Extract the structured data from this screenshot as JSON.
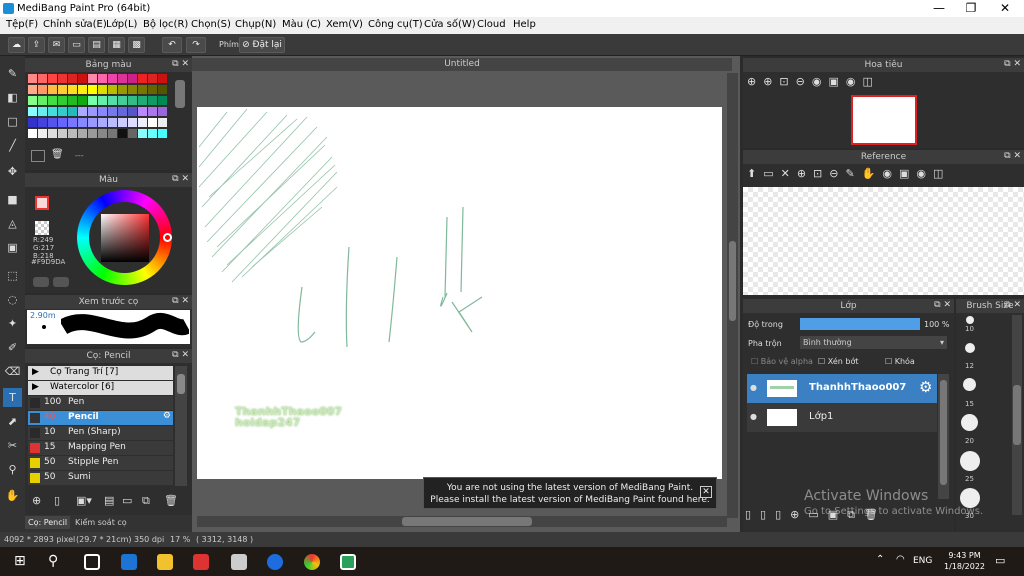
{
  "window": {
    "title": "MediBang Paint Pro (64bit)",
    "minimize": "—",
    "maximize": "❐",
    "close": "✕"
  },
  "menu": [
    "Tệp(F)",
    "Chỉnh sửa(E)",
    "Lớp(L)",
    "Bộ lọc(R)",
    "Chọn(S)",
    "Chụp(N)",
    "Màu (C)",
    "Xem(V)",
    "Công cụ(T)",
    "Cửa số(W)",
    "Cloud",
    "Help"
  ],
  "toolbar": {
    "shortcut_label": "Phím",
    "reset_label": "Đặt lại"
  },
  "canvas_tab": "Untitled",
  "swatches_panel": {
    "title": "Bảng màu",
    "dots": "---"
  },
  "color_panel": {
    "title": "Màu",
    "r": "R:249",
    "g": "G:217",
    "b": "B:218",
    "hex": "#F9D9DA"
  },
  "brush_preview": {
    "title": "Xem trước cọ",
    "size": "2.90m"
  },
  "brush_panel": {
    "title": "Cọ: Pencil",
    "groups": [
      "Cọ Trang Trí [7]",
      "Watercolor [6]"
    ],
    "items": [
      {
        "size": "100",
        "name": "Pen",
        "color": "#2a2a2a"
      },
      {
        "size": "40",
        "name": "Pencil",
        "color": "#333"
      },
      {
        "size": "10",
        "name": "Pen (Sharp)",
        "color": "#2a2a2a"
      },
      {
        "size": "15",
        "name": "Mapping Pen",
        "color": "#d33"
      },
      {
        "size": "50",
        "name": "Stipple Pen",
        "color": "#e6d000"
      },
      {
        "size": "50",
        "name": "Sumi",
        "color": "#e6d000"
      }
    ],
    "tab1": "Cọ: Pencil",
    "tab2": "Kiểm soát cọ"
  },
  "navigator": {
    "title": "Hoa tiêu"
  },
  "reference": {
    "title": "Reference"
  },
  "layers": {
    "title": "Lớp",
    "opacity_label": "Độ trong",
    "opacity_value": "100 %",
    "opacity_fraction": 1.0,
    "blend_label": "Pha trộn",
    "blend_value": "Bình thường",
    "protect_alpha": "Bảo vệ alpha",
    "clipping": "Xén bớt",
    "lock": "Khóa",
    "rows": [
      {
        "name": "ThanhhThaoo007",
        "selected": true
      },
      {
        "name": "Lớp1",
        "selected": false
      }
    ]
  },
  "brush_size": {
    "title": "Brush Size",
    "sizes": [
      "10",
      "12",
      "15",
      "20",
      "25",
      "30"
    ]
  },
  "canvas_text": {
    "line1": "ThanhhThaoo007",
    "line2": "hoidap247"
  },
  "notification": {
    "line1": "You are not using the latest version of MediBang Paint.",
    "line2": "Please install the latest version of MediBang Paint found here."
  },
  "watermark": {
    "line1": "Activate Windows",
    "line2": "Go to Settings to activate Windows."
  },
  "status": {
    "dims": "4092 * 2893 pixel",
    "size": "(29.7 * 21cm)",
    "dpi": "350 dpi",
    "zoom": "17 %",
    "coords": "( 3312, 3148 )"
  },
  "taskbar": {
    "time": "9:43 PM",
    "date": "1/18/2022",
    "lang": "ENG"
  }
}
